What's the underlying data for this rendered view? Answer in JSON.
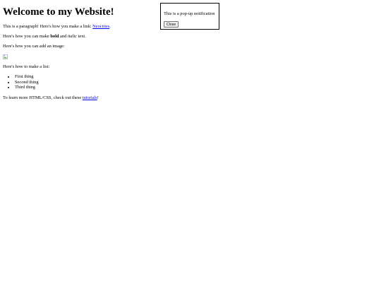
{
  "page": {
    "heading": "Welcome to my Website!",
    "paragraph1": {
      "text_before": "This is a paragraph! Here's how you make a link: ",
      "link_text": "Neocities",
      "text_after": "."
    },
    "paragraph2": {
      "text_before": "Here's how you can make ",
      "bold_text": "bold",
      "text_middle": " and ",
      "italic_text": "italic",
      "text_after": " text."
    },
    "paragraph3": "Here's how you can add an image:",
    "image_icon": "broken-image-icon",
    "paragraph4": "Here's how to make a list:",
    "list_items": [
      "First thing",
      "Second thing",
      "Third thing"
    ],
    "paragraph5": {
      "text_before": "To learn more HTML/CSS, check out these ",
      "link_text": "tutorials",
      "text_after": "!"
    }
  },
  "popup": {
    "message": "This is a pop-up notification",
    "close_label": "Close"
  },
  "colors": {
    "link": "#0000ee",
    "background": "#ffffff",
    "text": "#000000"
  }
}
